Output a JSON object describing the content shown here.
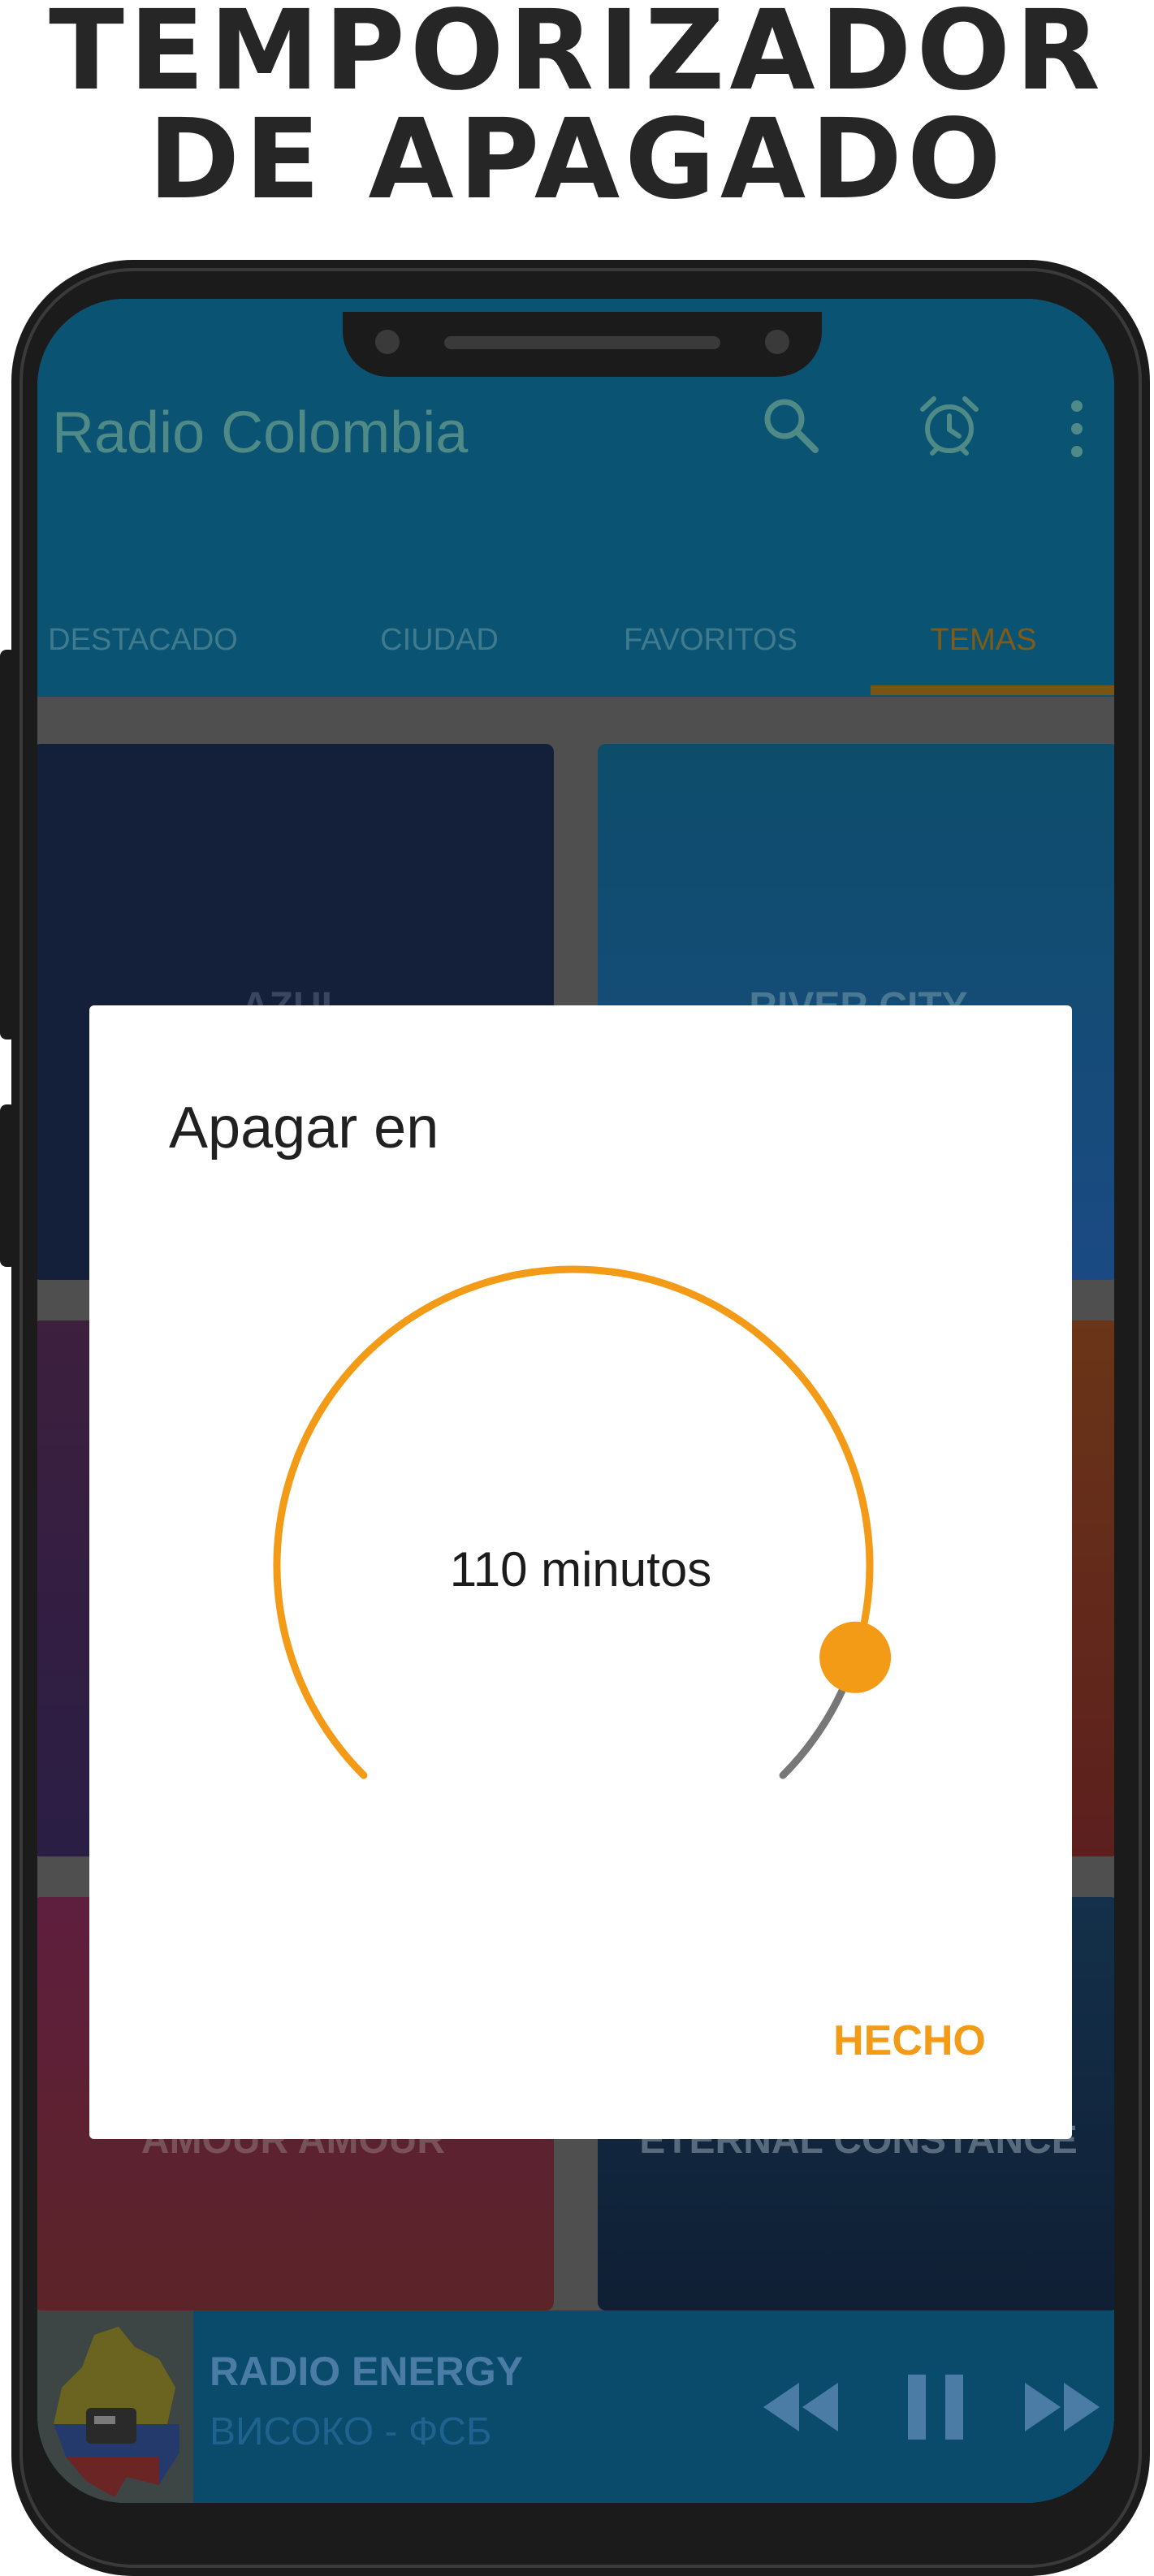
{
  "banner": {
    "line1": "TEMPORIZADOR",
    "line2": "DE APAGADO"
  },
  "app": {
    "title": "Radio Colombia",
    "toolbar_icons": [
      "search-icon",
      "alarm-clock-icon",
      "more-vert-icon"
    ],
    "tabs": [
      {
        "label": "DESTACADO",
        "active": false
      },
      {
        "label": "CIUDAD",
        "active": false
      },
      {
        "label": "FAVORITOS",
        "active": false
      },
      {
        "label": "TEMAS",
        "active": true
      }
    ]
  },
  "themes": [
    {
      "label": "AZUL",
      "color_top": "#141f39",
      "color_bottom": "#141f39"
    },
    {
      "label": "RIVER CITY",
      "color_top": "#0d4d6a",
      "color_bottom": "#1b4a83"
    },
    {
      "label": "",
      "color_top": "#3d1f3e",
      "color_bottom": "#2a1e45"
    },
    {
      "label": "",
      "color_top": "#6a3518",
      "color_bottom": "#5c1f1e"
    },
    {
      "label": "AMOUR AMOUR",
      "color_top": "#5e1e3e",
      "color_bottom": "#5c2428"
    },
    {
      "label": "ETERNAL CONSTANCE",
      "color_top": "#14304a",
      "color_bottom": "#0f1f34"
    }
  ],
  "player": {
    "station": "RADIO ENERGY",
    "subtitle": "ВИСОКО - ФСБ",
    "controls": [
      "rewind-icon",
      "pause-icon",
      "fast-forward-icon"
    ]
  },
  "dialog": {
    "title": "Apagar en",
    "value_text": "110 minutos",
    "value_minutes": 110,
    "progress_fraction": 0.9,
    "done_label": "HECHO",
    "accent": "#f39a16",
    "track": "#777777"
  },
  "colors": {
    "appbar": "#0b5372",
    "scrim": "#4f4f4f"
  }
}
